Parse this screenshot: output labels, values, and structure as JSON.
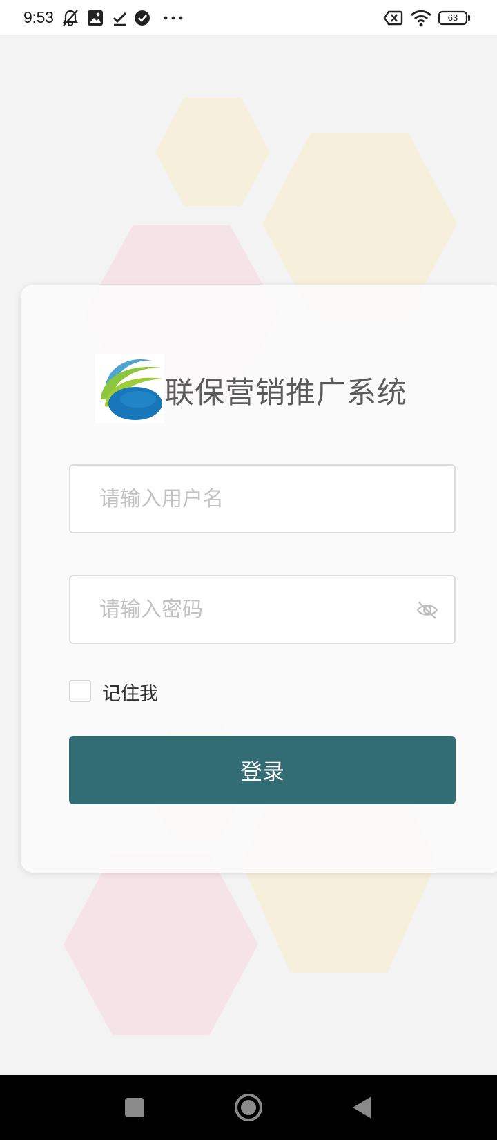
{
  "status_bar": {
    "time": "9:53",
    "battery_level": "63",
    "icons": [
      "notifications-muted-icon",
      "gallery-icon",
      "checkmark-icon",
      "verified-icon",
      "more-dots-icon",
      "sim-disabled-icon",
      "wifi-icon",
      "battery-icon"
    ]
  },
  "login": {
    "app_title": "联保营销推广系统",
    "username_placeholder": "请输入用户名",
    "password_placeholder": "请输入密码",
    "remember_label": "记住我",
    "login_button_label": "登录"
  },
  "colors": {
    "accent": "#326d73",
    "background": "#f3f3f3",
    "card": "#fafafa",
    "hex_yellow": "#f6efdb",
    "hex_pink": "#f6e3e7"
  },
  "navigation": {
    "buttons": [
      "recents-square-icon",
      "home-circle-icon",
      "back-triangle-icon"
    ]
  }
}
